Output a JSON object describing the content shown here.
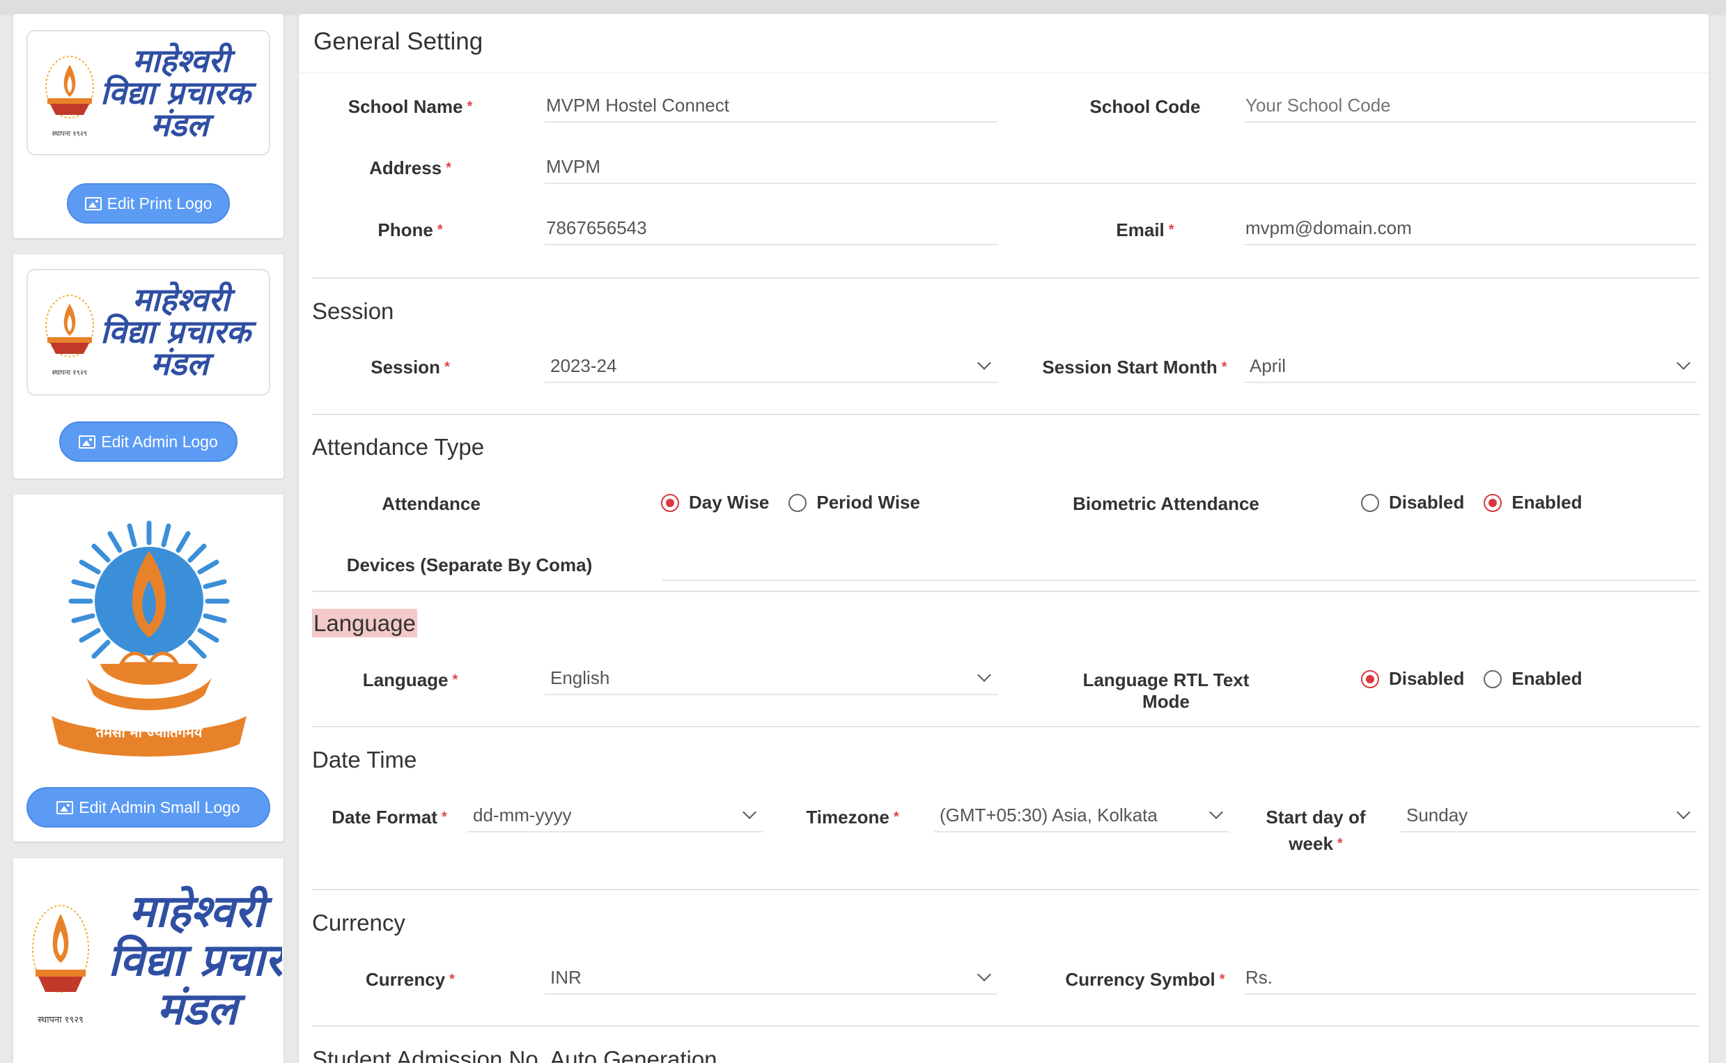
{
  "sidebar": {
    "logos": [
      {
        "button_label": "Edit Print Logo"
      },
      {
        "button_label": "Edit Admin Logo"
      },
      {
        "button_label": "Edit Admin Small Logo"
      },
      {
        "button_label": ""
      }
    ]
  },
  "panel": {
    "title": "General Setting",
    "school_name": {
      "label": "School Name",
      "value": "MVPM Hostel Connect"
    },
    "school_code": {
      "label": "School Code",
      "placeholder": "Your School Code"
    },
    "address": {
      "label": "Address",
      "value": "MVPM"
    },
    "phone": {
      "label": "Phone",
      "value": "7867656543"
    },
    "email": {
      "label": "Email",
      "value": "mvpm@domain.com"
    }
  },
  "session": {
    "title": "Session",
    "session_label": "Session",
    "session_value": "2023-24",
    "start_month_label": "Session Start Month",
    "start_month_value": "April"
  },
  "attendance": {
    "title": "Attendance Type",
    "attendance_label": "Attendance",
    "options": [
      "Day Wise",
      "Period Wise"
    ],
    "selected": "Day Wise",
    "biometric_label": "Biometric Attendance",
    "biometric_options": [
      "Disabled",
      "Enabled"
    ],
    "biometric_selected": "Enabled",
    "devices_label": "Devices (Separate By Coma)",
    "devices_value": ""
  },
  "language": {
    "title": "Language",
    "language_label": "Language",
    "language_value": "English",
    "rtl_label": "Language RTL Text Mode",
    "rtl_options": [
      "Disabled",
      "Enabled"
    ],
    "rtl_selected": "Disabled"
  },
  "datetime": {
    "title": "Date Time",
    "date_format_label": "Date Format",
    "date_format_value": "dd-mm-yyyy",
    "timezone_label": "Timezone",
    "timezone_value": "(GMT+05:30) Asia, Kolkata",
    "start_day_label_1": "Start day of",
    "start_day_label_2": "week",
    "start_day_value": "Sunday"
  },
  "currency": {
    "title": "Currency",
    "currency_label": "Currency",
    "currency_value": "INR",
    "symbol_label": "Currency Symbol",
    "symbol_value": "Rs."
  },
  "admission": {
    "title": "Student Admission No. Auto Generation"
  },
  "colors": {
    "accent": "#5b9bf4",
    "required": "#e04646",
    "radio_on": "#d9393f",
    "logo_blue": "#2f4fa3",
    "logo_orange": "#e8822a"
  }
}
